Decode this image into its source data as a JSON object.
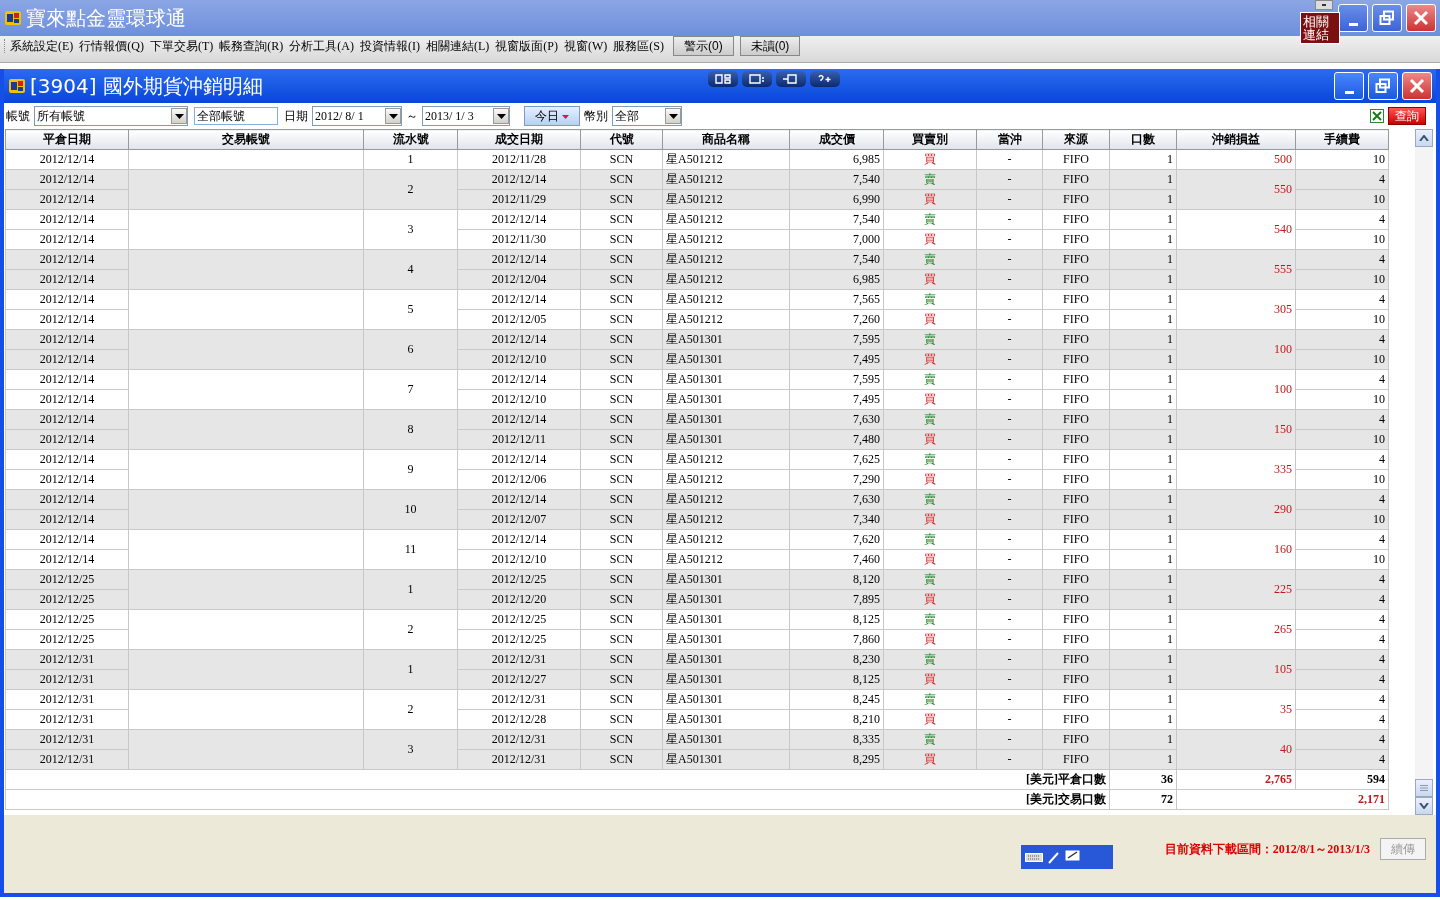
{
  "app": {
    "title": "寶來點金靈環球通",
    "popup": {
      "label": "相關連結"
    },
    "alerts": [
      {
        "label": "警示(0)"
      },
      {
        "label": "未讀(0)"
      }
    ]
  },
  "menu": [
    "系統設定(E)",
    "行情報價(Q)",
    "下單交易(T)",
    "帳務查詢(R)",
    "分析工具(A)",
    "投資情報(I)",
    "相關連結(L)",
    "視窗版面(P)",
    "視窗(W)",
    "服務區(S)"
  ],
  "report": {
    "title": "[3904] 國外期貨沖銷明細",
    "filters": {
      "account_label": "帳號",
      "account_select": "所有帳號",
      "account_input": "全部帳號",
      "date_label": "日期",
      "date_from": "2012/ 8/ 1",
      "date_sep": "～",
      "date_to": "2013/ 1/ 3",
      "today_button": "今日",
      "currency_label": "幣別",
      "currency_select": "全部",
      "query_button": "查詢"
    },
    "columns": [
      "平倉日期",
      "交易帳號",
      "流水號",
      "成交日期",
      "代號",
      "商品名稱",
      "成交價",
      "買賣別",
      "當沖",
      "來源",
      "口數",
      "沖銷損益",
      "手續費"
    ],
    "groups": [
      {
        "seq": "1",
        "pnl": "500",
        "legs": [
          {
            "close_date": "2012/12/14",
            "trade_date": "2012/11/28",
            "code": "SCN",
            "product": "星A501212",
            "price": "6,985",
            "side": "買",
            "kind": "buy",
            "daytrade": "-",
            "source": "FIFO",
            "qty": "1",
            "fee": "10"
          }
        ]
      },
      {
        "seq": "2",
        "pnl": "550",
        "legs": [
          {
            "close_date": "2012/12/14",
            "trade_date": "2012/12/14",
            "code": "SCN",
            "product": "星A501212",
            "price": "7,540",
            "side": "賣",
            "kind": "sell",
            "daytrade": "-",
            "source": "FIFO",
            "qty": "1",
            "fee": "4"
          },
          {
            "close_date": "2012/12/14",
            "trade_date": "2012/11/29",
            "code": "SCN",
            "product": "星A501212",
            "price": "6,990",
            "side": "買",
            "kind": "buy",
            "daytrade": "-",
            "source": "FIFO",
            "qty": "1",
            "fee": "10"
          }
        ]
      },
      {
        "seq": "3",
        "pnl": "540",
        "legs": [
          {
            "close_date": "2012/12/14",
            "trade_date": "2012/12/14",
            "code": "SCN",
            "product": "星A501212",
            "price": "7,540",
            "side": "賣",
            "kind": "sell",
            "daytrade": "-",
            "source": "FIFO",
            "qty": "1",
            "fee": "4"
          },
          {
            "close_date": "2012/12/14",
            "trade_date": "2012/11/30",
            "code": "SCN",
            "product": "星A501212",
            "price": "7,000",
            "side": "買",
            "kind": "buy",
            "daytrade": "-",
            "source": "FIFO",
            "qty": "1",
            "fee": "10"
          }
        ]
      },
      {
        "seq": "4",
        "pnl": "555",
        "legs": [
          {
            "close_date": "2012/12/14",
            "trade_date": "2012/12/14",
            "code": "SCN",
            "product": "星A501212",
            "price": "7,540",
            "side": "賣",
            "kind": "sell",
            "daytrade": "-",
            "source": "FIFO",
            "qty": "1",
            "fee": "4"
          },
          {
            "close_date": "2012/12/14",
            "trade_date": "2012/12/04",
            "code": "SCN",
            "product": "星A501212",
            "price": "6,985",
            "side": "買",
            "kind": "buy",
            "daytrade": "-",
            "source": "FIFO",
            "qty": "1",
            "fee": "10"
          }
        ]
      },
      {
        "seq": "5",
        "pnl": "305",
        "legs": [
          {
            "close_date": "2012/12/14",
            "trade_date": "2012/12/14",
            "code": "SCN",
            "product": "星A501212",
            "price": "7,565",
            "side": "賣",
            "kind": "sell",
            "daytrade": "-",
            "source": "FIFO",
            "qty": "1",
            "fee": "4"
          },
          {
            "close_date": "2012/12/14",
            "trade_date": "2012/12/05",
            "code": "SCN",
            "product": "星A501212",
            "price": "7,260",
            "side": "買",
            "kind": "buy",
            "daytrade": "-",
            "source": "FIFO",
            "qty": "1",
            "fee": "10"
          }
        ]
      },
      {
        "seq": "6",
        "pnl": "100",
        "legs": [
          {
            "close_date": "2012/12/14",
            "trade_date": "2012/12/14",
            "code": "SCN",
            "product": "星A501301",
            "price": "7,595",
            "side": "賣",
            "kind": "sell",
            "daytrade": "-",
            "source": "FIFO",
            "qty": "1",
            "fee": "4"
          },
          {
            "close_date": "2012/12/14",
            "trade_date": "2012/12/10",
            "code": "SCN",
            "product": "星A501301",
            "price": "7,495",
            "side": "買",
            "kind": "buy",
            "daytrade": "-",
            "source": "FIFO",
            "qty": "1",
            "fee": "10"
          }
        ]
      },
      {
        "seq": "7",
        "pnl": "100",
        "legs": [
          {
            "close_date": "2012/12/14",
            "trade_date": "2012/12/14",
            "code": "SCN",
            "product": "星A501301",
            "price": "7,595",
            "side": "賣",
            "kind": "sell",
            "daytrade": "-",
            "source": "FIFO",
            "qty": "1",
            "fee": "4"
          },
          {
            "close_date": "2012/12/14",
            "trade_date": "2012/12/10",
            "code": "SCN",
            "product": "星A501301",
            "price": "7,495",
            "side": "買",
            "kind": "buy",
            "daytrade": "-",
            "source": "FIFO",
            "qty": "1",
            "fee": "10"
          }
        ]
      },
      {
        "seq": "8",
        "pnl": "150",
        "legs": [
          {
            "close_date": "2012/12/14",
            "trade_date": "2012/12/14",
            "code": "SCN",
            "product": "星A501301",
            "price": "7,630",
            "side": "賣",
            "kind": "sell",
            "daytrade": "-",
            "source": "FIFO",
            "qty": "1",
            "fee": "4"
          },
          {
            "close_date": "2012/12/14",
            "trade_date": "2012/12/11",
            "code": "SCN",
            "product": "星A501301",
            "price": "7,480",
            "side": "買",
            "kind": "buy",
            "daytrade": "-",
            "source": "FIFO",
            "qty": "1",
            "fee": "10"
          }
        ]
      },
      {
        "seq": "9",
        "pnl": "335",
        "legs": [
          {
            "close_date": "2012/12/14",
            "trade_date": "2012/12/14",
            "code": "SCN",
            "product": "星A501212",
            "price": "7,625",
            "side": "賣",
            "kind": "sell",
            "daytrade": "-",
            "source": "FIFO",
            "qty": "1",
            "fee": "4"
          },
          {
            "close_date": "2012/12/14",
            "trade_date": "2012/12/06",
            "code": "SCN",
            "product": "星A501212",
            "price": "7,290",
            "side": "買",
            "kind": "buy",
            "daytrade": "-",
            "source": "FIFO",
            "qty": "1",
            "fee": "10"
          }
        ]
      },
      {
        "seq": "10",
        "pnl": "290",
        "legs": [
          {
            "close_date": "2012/12/14",
            "trade_date": "2012/12/14",
            "code": "SCN",
            "product": "星A501212",
            "price": "7,630",
            "side": "賣",
            "kind": "sell",
            "daytrade": "-",
            "source": "FIFO",
            "qty": "1",
            "fee": "4"
          },
          {
            "close_date": "2012/12/14",
            "trade_date": "2012/12/07",
            "code": "SCN",
            "product": "星A501212",
            "price": "7,340",
            "side": "買",
            "kind": "buy",
            "daytrade": "-",
            "source": "FIFO",
            "qty": "1",
            "fee": "10"
          }
        ]
      },
      {
        "seq": "11",
        "pnl": "160",
        "legs": [
          {
            "close_date": "2012/12/14",
            "trade_date": "2012/12/14",
            "code": "SCN",
            "product": "星A501212",
            "price": "7,620",
            "side": "賣",
            "kind": "sell",
            "daytrade": "-",
            "source": "FIFO",
            "qty": "1",
            "fee": "4"
          },
          {
            "close_date": "2012/12/14",
            "trade_date": "2012/12/10",
            "code": "SCN",
            "product": "星A501212",
            "price": "7,460",
            "side": "買",
            "kind": "buy",
            "daytrade": "-",
            "source": "FIFO",
            "qty": "1",
            "fee": "10"
          }
        ]
      },
      {
        "seq": "1",
        "pnl": "225",
        "legs": [
          {
            "close_date": "2012/12/25",
            "trade_date": "2012/12/25",
            "code": "SCN",
            "product": "星A501301",
            "price": "8,120",
            "side": "賣",
            "kind": "sell",
            "daytrade": "-",
            "source": "FIFO",
            "qty": "1",
            "fee": "4"
          },
          {
            "close_date": "2012/12/25",
            "trade_date": "2012/12/20",
            "code": "SCN",
            "product": "星A501301",
            "price": "7,895",
            "side": "買",
            "kind": "buy",
            "daytrade": "-",
            "source": "FIFO",
            "qty": "1",
            "fee": "4"
          }
        ]
      },
      {
        "seq": "2",
        "pnl": "265",
        "legs": [
          {
            "close_date": "2012/12/25",
            "trade_date": "2012/12/25",
            "code": "SCN",
            "product": "星A501301",
            "price": "8,125",
            "side": "賣",
            "kind": "sell",
            "daytrade": "-",
            "source": "FIFO",
            "qty": "1",
            "fee": "4"
          },
          {
            "close_date": "2012/12/25",
            "trade_date": "2012/12/25",
            "code": "SCN",
            "product": "星A501301",
            "price": "7,860",
            "side": "買",
            "kind": "buy",
            "daytrade": "-",
            "source": "FIFO",
            "qty": "1",
            "fee": "4"
          }
        ]
      },
      {
        "seq": "1",
        "pnl": "105",
        "legs": [
          {
            "close_date": "2012/12/31",
            "trade_date": "2012/12/31",
            "code": "SCN",
            "product": "星A501301",
            "price": "8,230",
            "side": "賣",
            "kind": "sell",
            "daytrade": "-",
            "source": "FIFO",
            "qty": "1",
            "fee": "4"
          },
          {
            "close_date": "2012/12/31",
            "trade_date": "2012/12/27",
            "code": "SCN",
            "product": "星A501301",
            "price": "8,125",
            "side": "買",
            "kind": "buy",
            "daytrade": "-",
            "source": "FIFO",
            "qty": "1",
            "fee": "4"
          }
        ]
      },
      {
        "seq": "2",
        "pnl": "35",
        "legs": [
          {
            "close_date": "2012/12/31",
            "trade_date": "2012/12/31",
            "code": "SCN",
            "product": "星A501301",
            "price": "8,245",
            "side": "賣",
            "kind": "sell",
            "daytrade": "-",
            "source": "FIFO",
            "qty": "1",
            "fee": "4"
          },
          {
            "close_date": "2012/12/31",
            "trade_date": "2012/12/28",
            "code": "SCN",
            "product": "星A501301",
            "price": "8,210",
            "side": "買",
            "kind": "buy",
            "daytrade": "-",
            "source": "FIFO",
            "qty": "1",
            "fee": "4"
          }
        ]
      },
      {
        "seq": "3",
        "pnl": "40",
        "legs": [
          {
            "close_date": "2012/12/31",
            "trade_date": "2012/12/31",
            "code": "SCN",
            "product": "星A501301",
            "price": "8,335",
            "side": "賣",
            "kind": "sell",
            "daytrade": "-",
            "source": "FIFO",
            "qty": "1",
            "fee": "4"
          },
          {
            "close_date": "2012/12/31",
            "trade_date": "2012/12/31",
            "code": "SCN",
            "product": "星A501301",
            "price": "8,295",
            "side": "買",
            "kind": "buy",
            "daytrade": "-",
            "source": "FIFO",
            "qty": "1",
            "fee": "4"
          }
        ]
      }
    ],
    "summary": [
      {
        "label": "[美元]平倉口數",
        "qty": "36",
        "pnl": "2,765",
        "fee": "594"
      },
      {
        "label": "[美元]交易口數",
        "qty": "72",
        "total": "2,171"
      }
    ],
    "footer": {
      "range": "目前資料下載區間：2012/8/1～2013/1/3",
      "resume_button": {
        "label": "續傳",
        "disabled": true
      }
    }
  }
}
